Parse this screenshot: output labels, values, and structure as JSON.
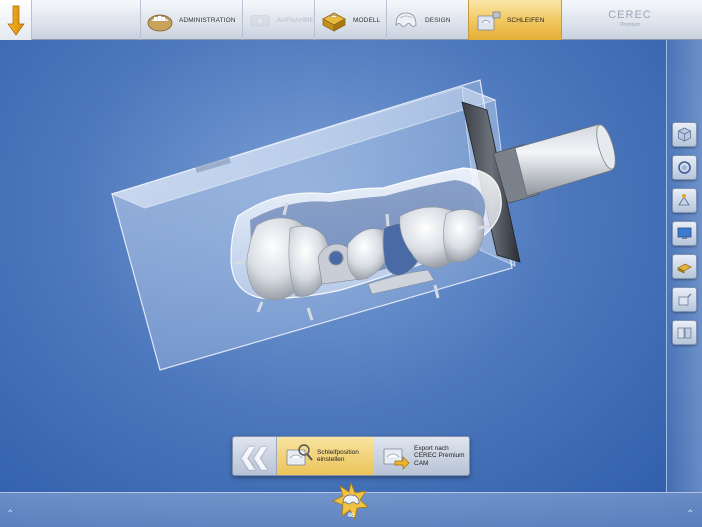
{
  "topbar": {
    "steps": [
      {
        "label": "ADMINISTRATION",
        "state": "normal"
      },
      {
        "label": "AUFNAHME",
        "state": "disabled"
      },
      {
        "label": "MODELL",
        "state": "normal"
      },
      {
        "label": "DESIGN",
        "state": "normal"
      },
      {
        "label": "SCHLEIFEN",
        "state": "active"
      }
    ],
    "logo": {
      "brand": "CEREC",
      "edition": "Premium"
    }
  },
  "right_toolbar": {
    "icons": [
      "view-cube-icon",
      "rotate-icon",
      "position-adjust-icon",
      "monitor-icon",
      "material-block-icon",
      "sprue-icon",
      "blocks-icon"
    ]
  },
  "action_panel": {
    "back_icon": "double-chevron-left-icon",
    "buttons": [
      {
        "line1": "Schleifposition",
        "line2": "einstellen",
        "line3": "",
        "state": "active",
        "icon": "grind-position-icon"
      },
      {
        "line1": "Export nach",
        "line2": "CEREC Premium",
        "line3": "CAM",
        "state": "normal",
        "icon": "export-icon"
      }
    ]
  },
  "bottom": {
    "tooth_number": "46"
  },
  "colors": {
    "accent": "#f1c65d",
    "background": "#4d78bd",
    "toolbar": "#dde3ec"
  }
}
